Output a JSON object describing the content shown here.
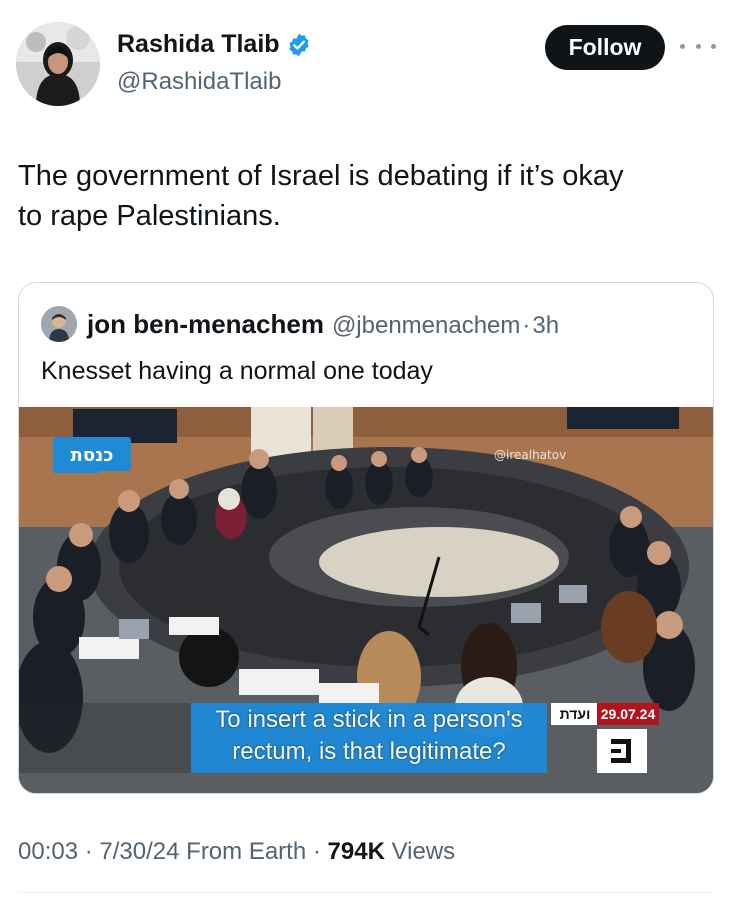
{
  "author": {
    "name": "Rashida Tlaib",
    "handle": "@RashidaTlaib",
    "verified": true
  },
  "follow_button": {
    "label": "Follow"
  },
  "tweet": {
    "text_line1": "The government of Israel is debating if it’s okay",
    "text_line2": "to rape Palestinians."
  },
  "quoted_tweet": {
    "name": "jon ben-menachem",
    "handle": "@jbenmenachem",
    "separator": "·",
    "time": "3h",
    "text": "Knesset having a normal one today",
    "media": {
      "caption_line1": "To insert a stick in a person's",
      "caption_line2": "rectum, is that legitimate?",
      "date_tag": "29.07.24",
      "watermark": "@irealhatov"
    }
  },
  "meta": {
    "time": "00:03",
    "sep1": "·",
    "date": "7/30/24",
    "source": "From Earth",
    "sep2": "·",
    "views": "794K",
    "views_label": "Views"
  },
  "colors": {
    "text_primary": "#0f1419",
    "text_secondary": "#536471",
    "verified_blue": "#1d9bf0",
    "follow_bg": "#0f1419",
    "caption_blue": "#1f8ad6",
    "date_red": "#b3141c"
  },
  "icons": {
    "verified": "verified-badge-icon",
    "more": "more-dots-icon"
  }
}
